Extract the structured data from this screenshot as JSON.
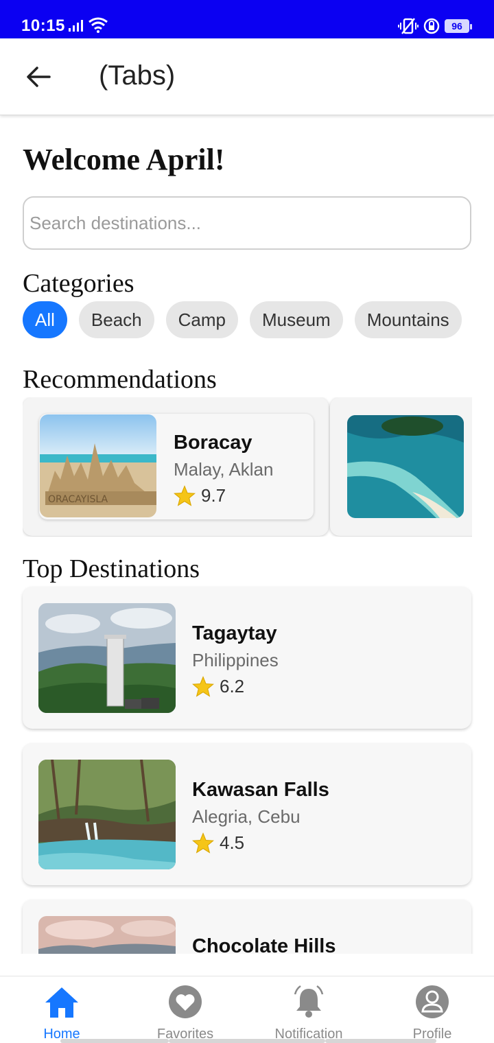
{
  "status_bar": {
    "time": "10:15",
    "battery": "96"
  },
  "app_bar": {
    "title": "(Tabs)"
  },
  "welcome": "Welcome April!",
  "search": {
    "placeholder": "Search destinations...",
    "value": ""
  },
  "categories": {
    "title": "Categories",
    "items": [
      {
        "label": "All",
        "active": true
      },
      {
        "label": "Beach",
        "active": false
      },
      {
        "label": "Camp",
        "active": false
      },
      {
        "label": "Museum",
        "active": false
      },
      {
        "label": "Mountains",
        "active": false
      }
    ]
  },
  "recommendations": {
    "title": "Recommendations",
    "items": [
      {
        "name": "Boracay",
        "location": "Malay, Aklan",
        "rating": "9.7"
      }
    ]
  },
  "top_destinations": {
    "title": "Top Destinations",
    "items": [
      {
        "name": "Tagaytay",
        "location": "Philippines",
        "rating": "6.2"
      },
      {
        "name": "Kawasan Falls",
        "location": "Alegria, Cebu",
        "rating": "4.5"
      },
      {
        "name": "Chocolate Hills",
        "location": "",
        "rating": ""
      }
    ]
  },
  "bottom_nav": {
    "items": [
      {
        "label": "Home",
        "icon": "home-icon",
        "active": true
      },
      {
        "label": "Favorites",
        "icon": "heart-icon",
        "active": false
      },
      {
        "label": "Notification",
        "icon": "bell-icon",
        "active": false
      },
      {
        "label": "Profile",
        "icon": "profile-icon",
        "active": false
      }
    ]
  },
  "colors": {
    "status_bar": "#0b00f2",
    "accent": "#1677ff",
    "star": "#f5c518"
  }
}
